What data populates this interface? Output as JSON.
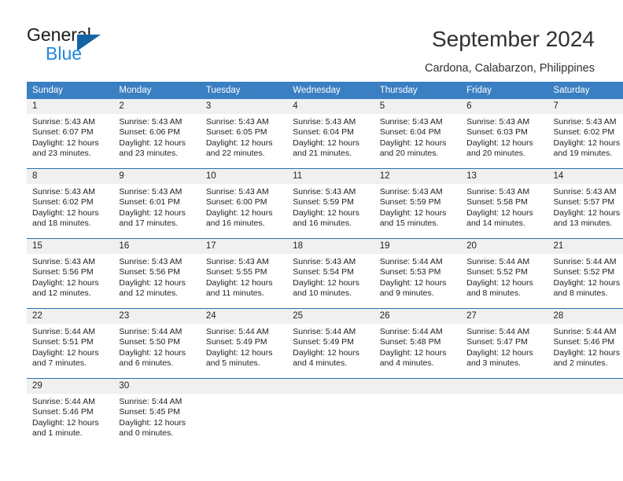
{
  "brand": {
    "name_top": "General",
    "name_bottom": "Blue",
    "triangle_icon": "triangle-icon",
    "accent_dark": "#1464a5",
    "accent_light": "#2288dd"
  },
  "header": {
    "title": "September 2024",
    "subtitle": "Cardona, Calabarzon, Philippines"
  },
  "calendar": {
    "header_bg": "#3a7fc1",
    "header_text": "#ffffff",
    "daynum_bg": "#f0f0f0",
    "row_divider": "#2a6ead",
    "weekday_headers": [
      "Sunday",
      "Monday",
      "Tuesday",
      "Wednesday",
      "Thursday",
      "Friday",
      "Saturday"
    ],
    "weeks": [
      [
        {
          "day": "1",
          "sunrise": "Sunrise: 5:43 AM",
          "sunset": "Sunset: 6:07 PM",
          "daylight_1": "Daylight: 12 hours",
          "daylight_2": "and 23 minutes."
        },
        {
          "day": "2",
          "sunrise": "Sunrise: 5:43 AM",
          "sunset": "Sunset: 6:06 PM",
          "daylight_1": "Daylight: 12 hours",
          "daylight_2": "and 23 minutes."
        },
        {
          "day": "3",
          "sunrise": "Sunrise: 5:43 AM",
          "sunset": "Sunset: 6:05 PM",
          "daylight_1": "Daylight: 12 hours",
          "daylight_2": "and 22 minutes."
        },
        {
          "day": "4",
          "sunrise": "Sunrise: 5:43 AM",
          "sunset": "Sunset: 6:04 PM",
          "daylight_1": "Daylight: 12 hours",
          "daylight_2": "and 21 minutes."
        },
        {
          "day": "5",
          "sunrise": "Sunrise: 5:43 AM",
          "sunset": "Sunset: 6:04 PM",
          "daylight_1": "Daylight: 12 hours",
          "daylight_2": "and 20 minutes."
        },
        {
          "day": "6",
          "sunrise": "Sunrise: 5:43 AM",
          "sunset": "Sunset: 6:03 PM",
          "daylight_1": "Daylight: 12 hours",
          "daylight_2": "and 20 minutes."
        },
        {
          "day": "7",
          "sunrise": "Sunrise: 5:43 AM",
          "sunset": "Sunset: 6:02 PM",
          "daylight_1": "Daylight: 12 hours",
          "daylight_2": "and 19 minutes."
        }
      ],
      [
        {
          "day": "8",
          "sunrise": "Sunrise: 5:43 AM",
          "sunset": "Sunset: 6:02 PM",
          "daylight_1": "Daylight: 12 hours",
          "daylight_2": "and 18 minutes."
        },
        {
          "day": "9",
          "sunrise": "Sunrise: 5:43 AM",
          "sunset": "Sunset: 6:01 PM",
          "daylight_1": "Daylight: 12 hours",
          "daylight_2": "and 17 minutes."
        },
        {
          "day": "10",
          "sunrise": "Sunrise: 5:43 AM",
          "sunset": "Sunset: 6:00 PM",
          "daylight_1": "Daylight: 12 hours",
          "daylight_2": "and 16 minutes."
        },
        {
          "day": "11",
          "sunrise": "Sunrise: 5:43 AM",
          "sunset": "Sunset: 5:59 PM",
          "daylight_1": "Daylight: 12 hours",
          "daylight_2": "and 16 minutes."
        },
        {
          "day": "12",
          "sunrise": "Sunrise: 5:43 AM",
          "sunset": "Sunset: 5:59 PM",
          "daylight_1": "Daylight: 12 hours",
          "daylight_2": "and 15 minutes."
        },
        {
          "day": "13",
          "sunrise": "Sunrise: 5:43 AM",
          "sunset": "Sunset: 5:58 PM",
          "daylight_1": "Daylight: 12 hours",
          "daylight_2": "and 14 minutes."
        },
        {
          "day": "14",
          "sunrise": "Sunrise: 5:43 AM",
          "sunset": "Sunset: 5:57 PM",
          "daylight_1": "Daylight: 12 hours",
          "daylight_2": "and 13 minutes."
        }
      ],
      [
        {
          "day": "15",
          "sunrise": "Sunrise: 5:43 AM",
          "sunset": "Sunset: 5:56 PM",
          "daylight_1": "Daylight: 12 hours",
          "daylight_2": "and 12 minutes."
        },
        {
          "day": "16",
          "sunrise": "Sunrise: 5:43 AM",
          "sunset": "Sunset: 5:56 PM",
          "daylight_1": "Daylight: 12 hours",
          "daylight_2": "and 12 minutes."
        },
        {
          "day": "17",
          "sunrise": "Sunrise: 5:43 AM",
          "sunset": "Sunset: 5:55 PM",
          "daylight_1": "Daylight: 12 hours",
          "daylight_2": "and 11 minutes."
        },
        {
          "day": "18",
          "sunrise": "Sunrise: 5:43 AM",
          "sunset": "Sunset: 5:54 PM",
          "daylight_1": "Daylight: 12 hours",
          "daylight_2": "and 10 minutes."
        },
        {
          "day": "19",
          "sunrise": "Sunrise: 5:44 AM",
          "sunset": "Sunset: 5:53 PM",
          "daylight_1": "Daylight: 12 hours",
          "daylight_2": "and 9 minutes."
        },
        {
          "day": "20",
          "sunrise": "Sunrise: 5:44 AM",
          "sunset": "Sunset: 5:52 PM",
          "daylight_1": "Daylight: 12 hours",
          "daylight_2": "and 8 minutes."
        },
        {
          "day": "21",
          "sunrise": "Sunrise: 5:44 AM",
          "sunset": "Sunset: 5:52 PM",
          "daylight_1": "Daylight: 12 hours",
          "daylight_2": "and 8 minutes."
        }
      ],
      [
        {
          "day": "22",
          "sunrise": "Sunrise: 5:44 AM",
          "sunset": "Sunset: 5:51 PM",
          "daylight_1": "Daylight: 12 hours",
          "daylight_2": "and 7 minutes."
        },
        {
          "day": "23",
          "sunrise": "Sunrise: 5:44 AM",
          "sunset": "Sunset: 5:50 PM",
          "daylight_1": "Daylight: 12 hours",
          "daylight_2": "and 6 minutes."
        },
        {
          "day": "24",
          "sunrise": "Sunrise: 5:44 AM",
          "sunset": "Sunset: 5:49 PM",
          "daylight_1": "Daylight: 12 hours",
          "daylight_2": "and 5 minutes."
        },
        {
          "day": "25",
          "sunrise": "Sunrise: 5:44 AM",
          "sunset": "Sunset: 5:49 PM",
          "daylight_1": "Daylight: 12 hours",
          "daylight_2": "and 4 minutes."
        },
        {
          "day": "26",
          "sunrise": "Sunrise: 5:44 AM",
          "sunset": "Sunset: 5:48 PM",
          "daylight_1": "Daylight: 12 hours",
          "daylight_2": "and 4 minutes."
        },
        {
          "day": "27",
          "sunrise": "Sunrise: 5:44 AM",
          "sunset": "Sunset: 5:47 PM",
          "daylight_1": "Daylight: 12 hours",
          "daylight_2": "and 3 minutes."
        },
        {
          "day": "28",
          "sunrise": "Sunrise: 5:44 AM",
          "sunset": "Sunset: 5:46 PM",
          "daylight_1": "Daylight: 12 hours",
          "daylight_2": "and 2 minutes."
        }
      ],
      [
        {
          "day": "29",
          "sunrise": "Sunrise: 5:44 AM",
          "sunset": "Sunset: 5:46 PM",
          "daylight_1": "Daylight: 12 hours",
          "daylight_2": "and 1 minute."
        },
        {
          "day": "30",
          "sunrise": "Sunrise: 5:44 AM",
          "sunset": "Sunset: 5:45 PM",
          "daylight_1": "Daylight: 12 hours",
          "daylight_2": "and 0 minutes."
        },
        {
          "day": "",
          "sunrise": "",
          "sunset": "",
          "daylight_1": "",
          "daylight_2": ""
        },
        {
          "day": "",
          "sunrise": "",
          "sunset": "",
          "daylight_1": "",
          "daylight_2": ""
        },
        {
          "day": "",
          "sunrise": "",
          "sunset": "",
          "daylight_1": "",
          "daylight_2": ""
        },
        {
          "day": "",
          "sunrise": "",
          "sunset": "",
          "daylight_1": "",
          "daylight_2": ""
        },
        {
          "day": "",
          "sunrise": "",
          "sunset": "",
          "daylight_1": "",
          "daylight_2": ""
        }
      ]
    ]
  }
}
